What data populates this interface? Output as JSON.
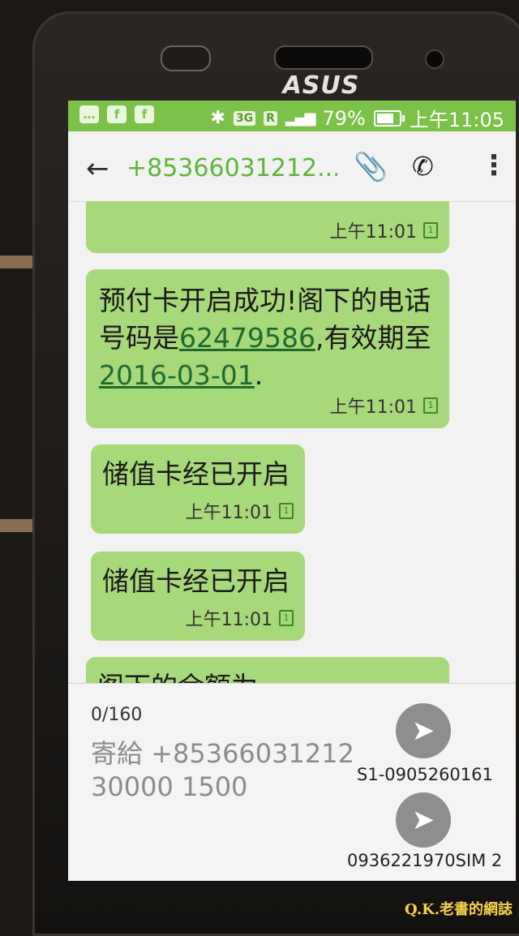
{
  "device": {
    "brand": "ASUS"
  },
  "status_bar": {
    "left_icons": [
      "chat-bubble-icon",
      "facebook-icon",
      "facebook-icon"
    ],
    "bluetooth": "bluetooth-icon",
    "network": "3G",
    "roaming": "R",
    "battery": "79%",
    "battery_level": 0.79,
    "time": "上午11:05"
  },
  "app_bar": {
    "title": "+85366031212..."
  },
  "messages": [
    {
      "text_parts": [
        {
          "t": "...",
          "link": false
        }
      ],
      "time": "上午11:01",
      "sim": "1"
    },
    {
      "text_parts": [
        {
          "t": "预付卡开启成功!阁下的电话号码是",
          "link": false
        },
        {
          "t": "62479586",
          "link": true
        },
        {
          "t": ",有效期至",
          "link": false
        },
        {
          "t": "2016-03-01",
          "link": true
        },
        {
          "t": ".",
          "link": false
        }
      ],
      "time": "上午11:01",
      "sim": "1"
    },
    {
      "text": "储值卡经已开启",
      "time": "上午11:01",
      "sim": "1"
    },
    {
      "text": "储值卡经已开启",
      "time": "上午11:01",
      "sim": "1"
    },
    {
      "text": "阁下的余额为",
      "time": "",
      "sim": ""
    }
  ],
  "composer": {
    "counter": "0/160",
    "text": "寄給 +8536603121230000 1500",
    "send1_label": "S1-0905260161",
    "send2_label": "0936221970SIM 2"
  },
  "watermark": "Q.K.老書的網誌",
  "colors": {
    "accent_green": "#7cc14a",
    "bubble_green": "#a7d879",
    "link_green": "#1f6b2f"
  }
}
